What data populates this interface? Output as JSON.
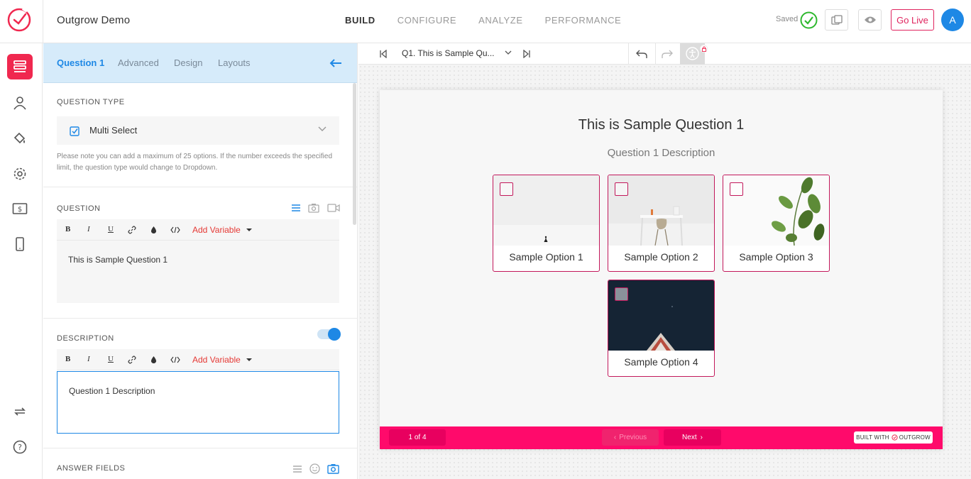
{
  "app": {
    "title": "Outgrow Demo"
  },
  "nav": {
    "items": [
      "BUILD",
      "CONFIGURE",
      "ANALYZE",
      "PERFORMANCE"
    ],
    "active": "BUILD"
  },
  "header": {
    "saved_label": "Saved",
    "go_live_label": "Go Live",
    "avatar_initial": "A"
  },
  "colors": {
    "brand": "#f0284f",
    "accent": "#1e88e5",
    "quiz_footer": "#ff0a6b",
    "option_border": "#c2185b"
  },
  "rail": {
    "icons": [
      "build-icon",
      "user-icon",
      "paint-bucket-icon",
      "gear-icon",
      "money-icon",
      "mobile-icon",
      "refresh-icon",
      "help-icon"
    ]
  },
  "panel": {
    "tabs": [
      "Question 1",
      "Advanced",
      "Design",
      "Layouts"
    ],
    "question_type": {
      "label": "QUESTION TYPE",
      "value": "Multi Select",
      "note": "Please note you can add a maximum of 25 options. If the number exceeds the specified limit, the question type would change to Dropdown."
    },
    "question": {
      "label": "QUESTION",
      "text": "This is Sample Question 1",
      "add_variable": "Add Variable"
    },
    "description": {
      "label": "DESCRIPTION",
      "text": "Question 1 Description",
      "add_variable": "Add Variable",
      "enabled": true
    },
    "answer_fields": {
      "label": "ANSWER FIELDS"
    },
    "toolbar_tools": [
      "B",
      "I",
      "U"
    ]
  },
  "canvas": {
    "question_selector": "Q1. This is Sample Qu...",
    "quiz": {
      "title": "This is Sample Question 1",
      "description": "Question 1 Description",
      "options": [
        "Sample Option 1",
        "Sample Option 2",
        "Sample Option 3",
        "Sample Option 4"
      ],
      "pager": "1 of 4",
      "previous_label": "Previous",
      "next_label": "Next",
      "built_with": "BUILT WITH",
      "brand_name": "OUTGROW"
    }
  }
}
